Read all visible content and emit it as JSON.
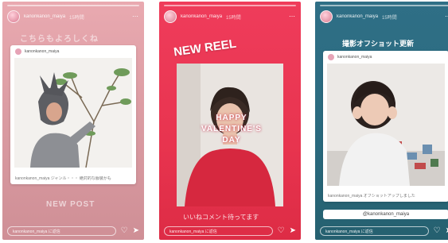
{
  "stories": [
    {
      "username": "kanonkanon_maiya",
      "time": "15時間",
      "headline": "こちらもよろしくね",
      "card_user": "kanonkanon_maiya",
      "card_caption": "kanonkanon_maiya  ジャンル・・・ 絶対的な服装かも",
      "bottom_text": "NEW POST",
      "reply_placeholder": "kanonkanon_maiya に返信"
    },
    {
      "username": "kanonkanon_maiya",
      "time": "15時間",
      "headline": "NEW REEL",
      "photo_text": "HAPPY VALENTINE'S DAY",
      "caption": "いいねコメント待ってます",
      "reply_placeholder": "kanonkanon_maiya に返信"
    },
    {
      "username": "kanonkanon_maiya",
      "time": "15時間",
      "headline": "撮影オフショット更新",
      "card_user": "kanonkanon_maiya",
      "card_caption": "kanonkanon_maiya  オフショットアップしました",
      "sticker_text": "@kanonkanon_maiya",
      "reply_placeholder": "kanonkanon_maiya に返信"
    }
  ],
  "colors": {
    "story1_bg": "#e3a3aa",
    "story2_bg": "#e8344f",
    "story3_bg": "#2c6c81"
  },
  "icons": [
    "more-icon",
    "heart-icon",
    "send-icon"
  ]
}
